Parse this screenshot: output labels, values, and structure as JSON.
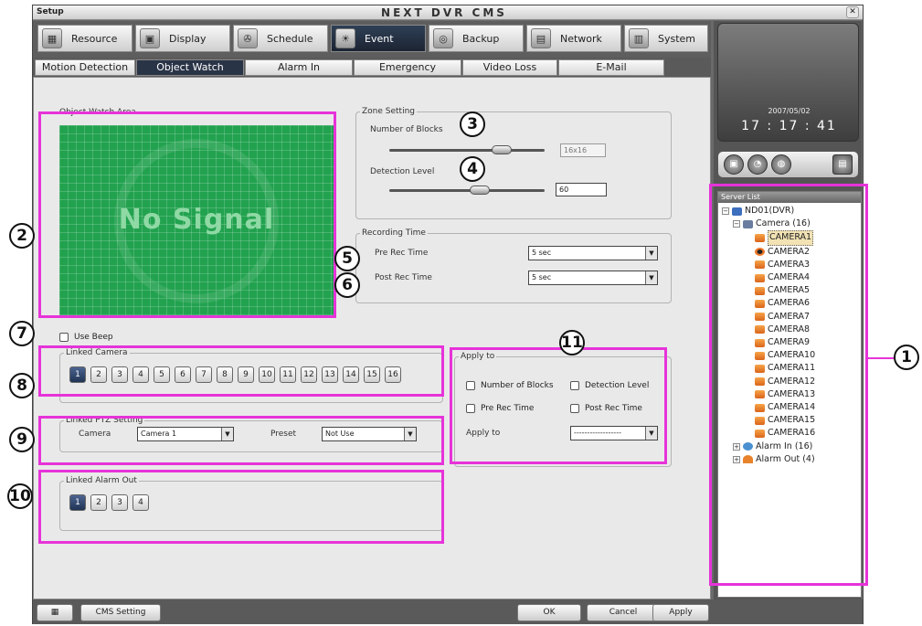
{
  "window": {
    "label": "Setup",
    "title": "NEXT DVR CMS",
    "close": "✕"
  },
  "menu": [
    {
      "label": "Resource",
      "icon": "resource-icon"
    },
    {
      "label": "Display",
      "icon": "display-icon"
    },
    {
      "label": "Schedule",
      "icon": "schedule-icon"
    },
    {
      "label": "Event",
      "icon": "event-icon"
    },
    {
      "label": "Backup",
      "icon": "backup-icon"
    },
    {
      "label": "Network",
      "icon": "network-icon"
    },
    {
      "label": "System",
      "icon": "system-icon"
    }
  ],
  "subtabs": [
    "Motion Detection",
    "Object Watch",
    "Alarm In",
    "Emergency",
    "Video Loss",
    "E-Mail"
  ],
  "object_watch": {
    "label": "Object Watch Area",
    "no_signal": "No Signal"
  },
  "zone": {
    "legend": "Zone Setting",
    "blocks_label": "Number of Blocks",
    "blocks_value": "16x16",
    "level_label": "Detection Level",
    "level_value": "60"
  },
  "recording": {
    "legend": "Recording Time",
    "pre_label": "Pre Rec Time",
    "pre_value": "5 sec",
    "post_label": "Post Rec Time",
    "post_value": "5 sec"
  },
  "beep": {
    "label": "Use Beep"
  },
  "linked_camera": {
    "legend": "Linked Camera",
    "buttons": [
      "1",
      "2",
      "3",
      "4",
      "5",
      "6",
      "7",
      "8",
      "9",
      "10",
      "11",
      "12",
      "13",
      "14",
      "15",
      "16"
    ],
    "selected": "1"
  },
  "ptz": {
    "legend": "Linked PTZ Setting",
    "camera_label": "Camera",
    "camera_value": "Camera 1",
    "preset_label": "Preset",
    "preset_value": "Not Use"
  },
  "alarm_out": {
    "legend": "Linked Alarm Out",
    "buttons": [
      "1",
      "2",
      "3",
      "4"
    ],
    "selected": "1"
  },
  "apply": {
    "legend": "Apply to",
    "blocks": "Number of Blocks",
    "level": "Detection Level",
    "pre": "Pre Rec Time",
    "post": "Post Rec Time",
    "apply_label": "Apply to",
    "apply_value": "------------------"
  },
  "bottom": {
    "cms_setting": "CMS Setting",
    "ok": "OK",
    "cancel": "Cancel",
    "apply": "Apply"
  },
  "clock": {
    "date": "2007/05/02",
    "time": "17 : 17 : 41"
  },
  "server": {
    "header": "Server List",
    "dvr": "ND01(DVR)",
    "camera_group": "Camera (16)",
    "cameras": [
      "CAMERA1",
      "CAMERA2",
      "CAMERA3",
      "CAMERA4",
      "CAMERA5",
      "CAMERA6",
      "CAMERA7",
      "CAMERA8",
      "CAMERA9",
      "CAMERA10",
      "CAMERA11",
      "CAMERA12",
      "CAMERA13",
      "CAMERA14",
      "CAMERA15",
      "CAMERA16"
    ],
    "alarm_in": "Alarm In (16)",
    "alarm_out": "Alarm Out (4)"
  },
  "callouts": [
    "1",
    "2",
    "3",
    "4",
    "5",
    "6",
    "7",
    "8",
    "9",
    "10",
    "11"
  ],
  "colors": {
    "highlight": "#e633d9",
    "active_tab": "#2a3447",
    "video_bg": "#22a24f"
  }
}
